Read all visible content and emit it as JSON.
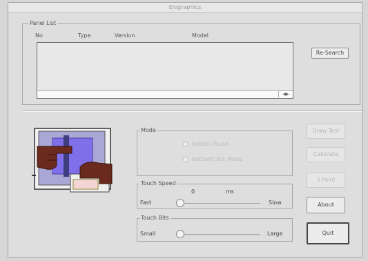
{
  "window": {
    "title": "Elographics"
  },
  "panel_list": {
    "label": "Panel List",
    "columns": [
      "No",
      "Type",
      "Version",
      "Model"
    ],
    "rows": []
  },
  "buttons": {
    "research": "Re-Search",
    "draw_test": "Draw Test",
    "calibration": "Calibrate",
    "three_point": "3 Point",
    "about": "About",
    "quit": "Quit"
  },
  "mode": {
    "label": "Mode",
    "option1": "Button Pause",
    "option2": "Button/Click Mode"
  },
  "touch_speed": {
    "label": "Touch Speed",
    "value": "0",
    "unit": "ms",
    "min_label": "Fast",
    "max_label": "Slow",
    "level": 0.0
  },
  "touch_bits": {
    "label": "Touch Bits",
    "min_label": "Small",
    "max_label": "Large",
    "level": 0.0
  },
  "colors": {
    "background": "#dedede",
    "logo_hand": "#6b2a1e",
    "logo_screen": "#8a7ae0",
    "logo_frame": "#9a98c8"
  }
}
